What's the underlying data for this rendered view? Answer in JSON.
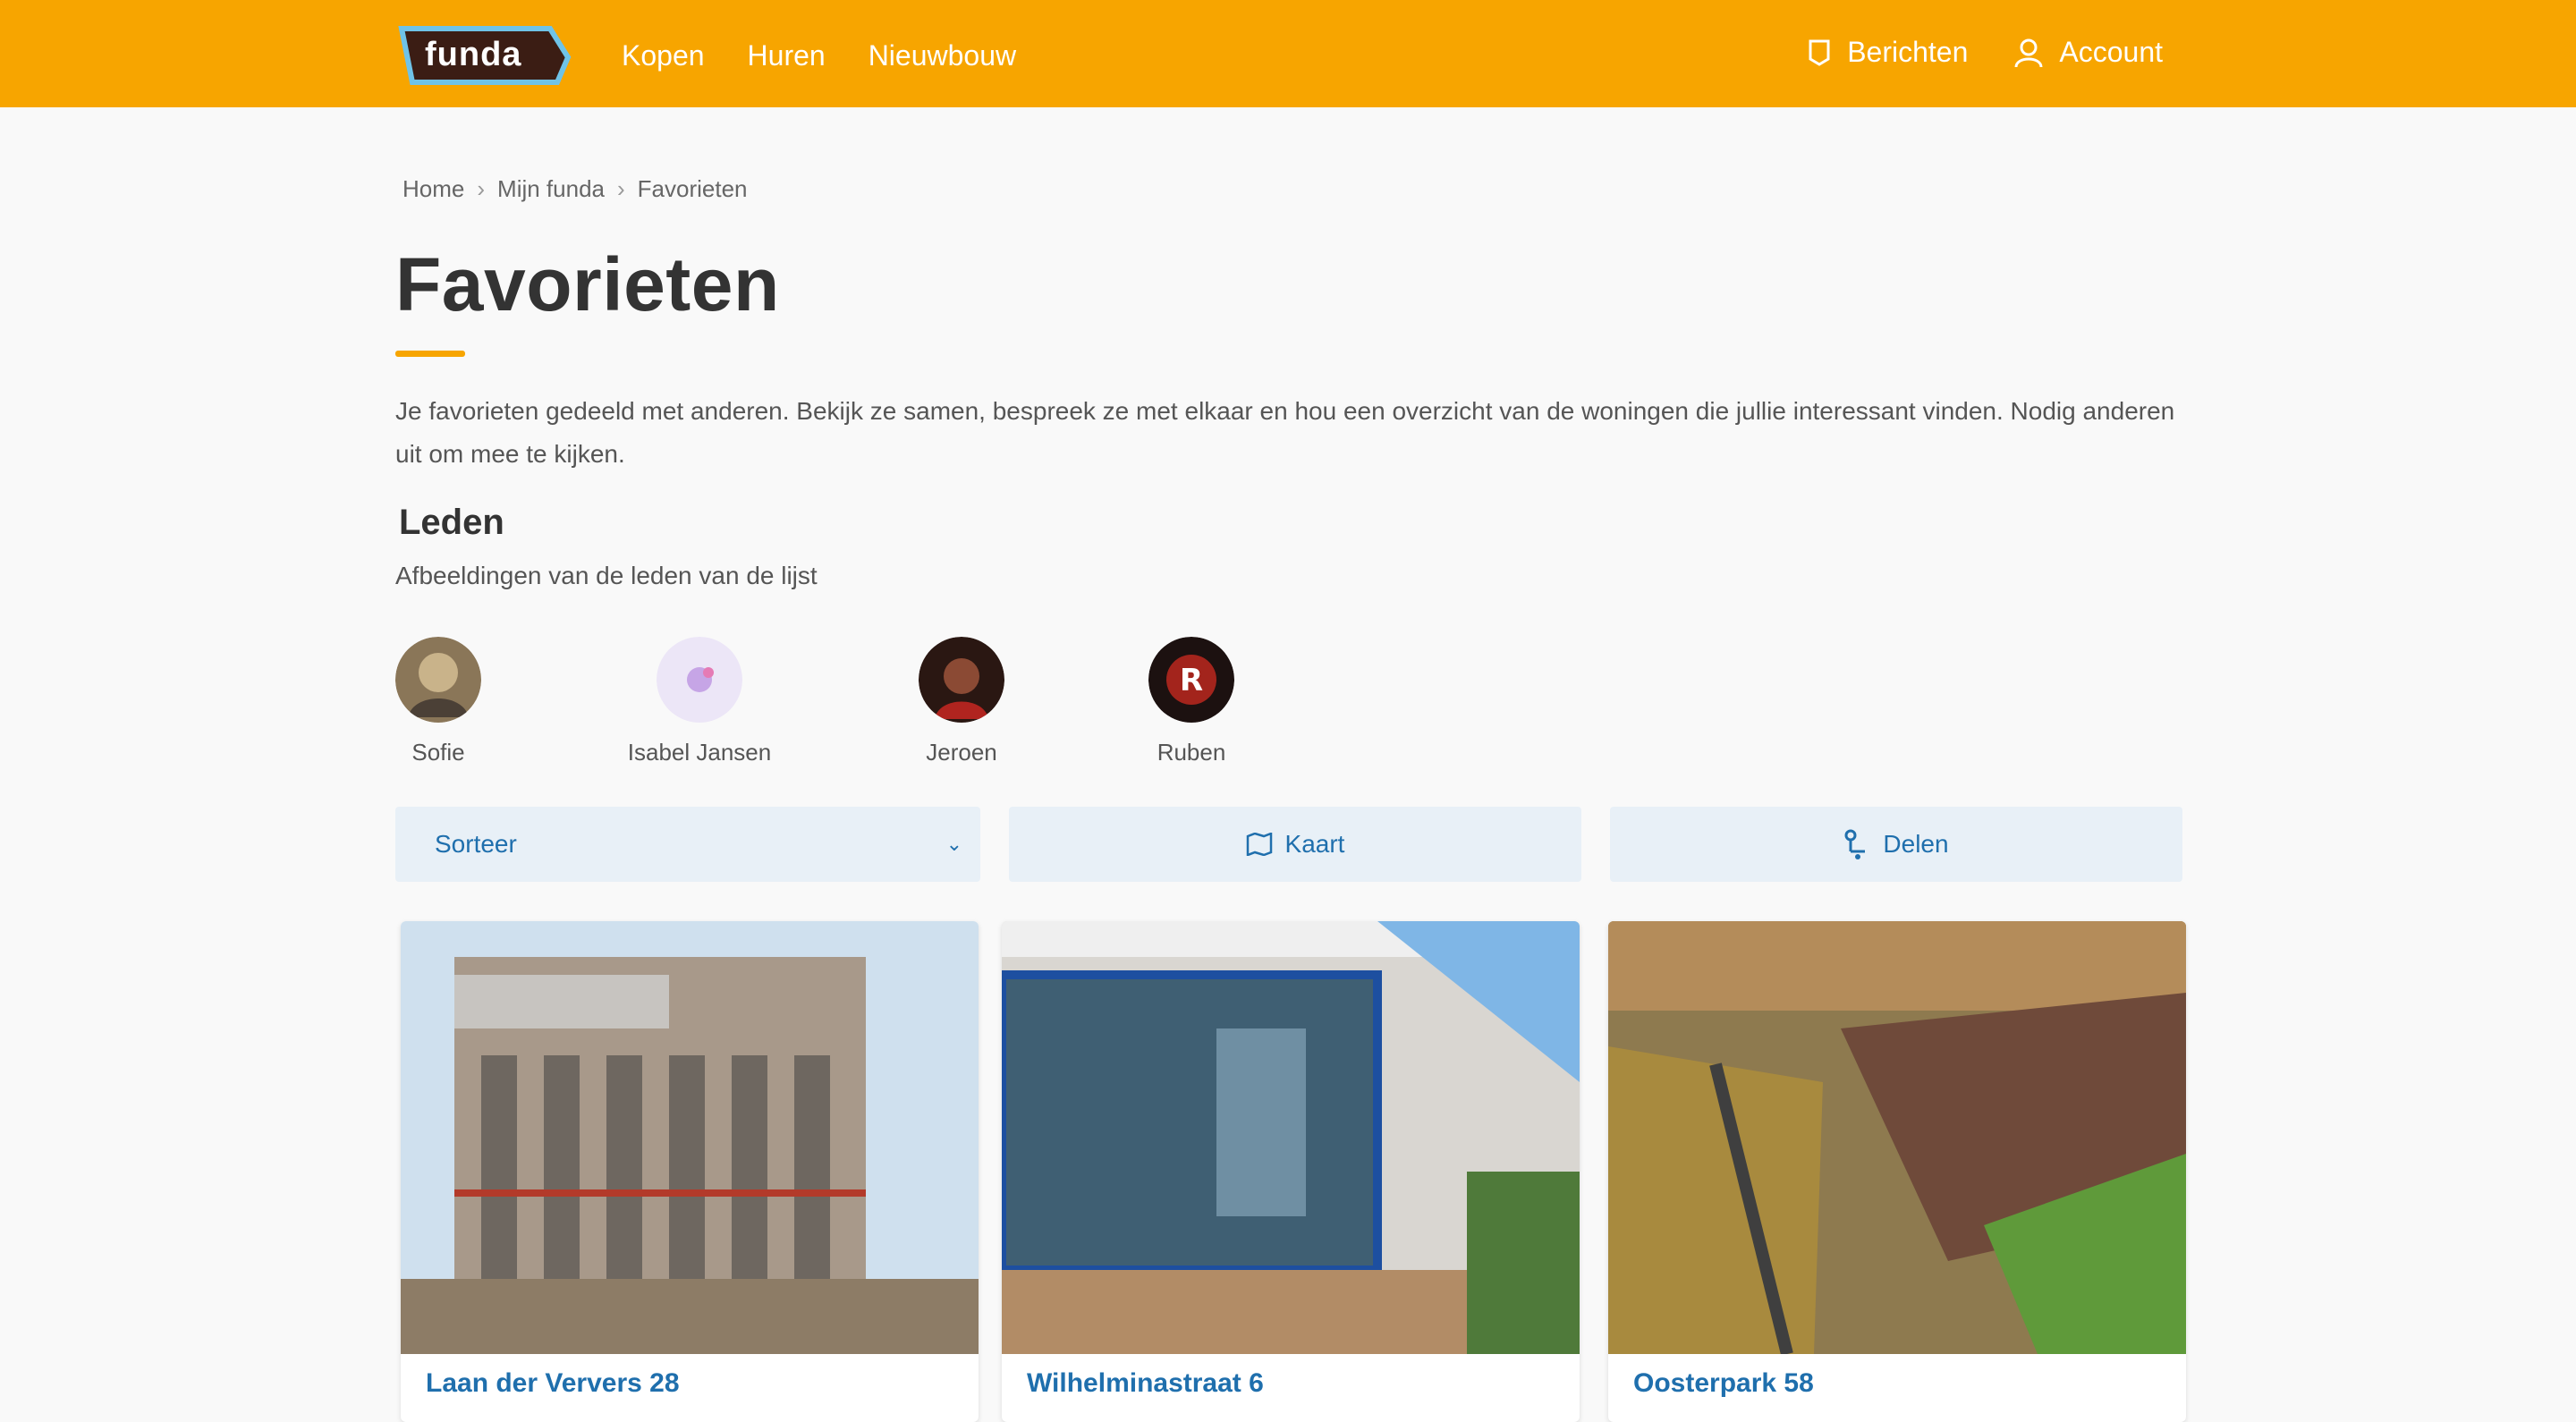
{
  "header": {
    "logo_text": "funda",
    "nav": [
      "Kopen",
      "Huren",
      "Nieuwbouw"
    ],
    "messages_label": "Berichten",
    "account_label": "Account",
    "colors": {
      "bar": "#f7a500",
      "logo_outline": "#6fc3e8",
      "logo_fill": "#3b1d14"
    }
  },
  "breadcrumb": [
    "Home",
    "Mijn funda",
    "Favorieten"
  ],
  "page": {
    "title": "Favorieten",
    "intro": "Je favorieten gedeeld met anderen. Bekijk ze samen, bespreek ze met elkaar en hou een overzicht van de woningen die jullie interessant vinden. Nodig anderen uit om mee te kijken.",
    "members_heading": "Leden",
    "members_sub": "Afbeeldingen van de leden van de lijst"
  },
  "members": [
    {
      "name": "Sofie",
      "avatar_icon": "avatar-photo-icon"
    },
    {
      "name": "Isabel Jansen",
      "avatar_icon": "avatar-initials-icon"
    },
    {
      "name": "Jeroen",
      "avatar_icon": "avatar-photo-icon"
    },
    {
      "name": "Ruben",
      "avatar_icon": "avatar-letter-r-icon"
    }
  ],
  "filters": {
    "sort_label": "Sorteer",
    "map_label": "Kaart",
    "share_label": "Delen"
  },
  "cards": [
    {
      "address": "Laan der Ververs 28"
    },
    {
      "address": "Wilhelminastraat 6"
    },
    {
      "address": "Oosterpark 58"
    }
  ]
}
